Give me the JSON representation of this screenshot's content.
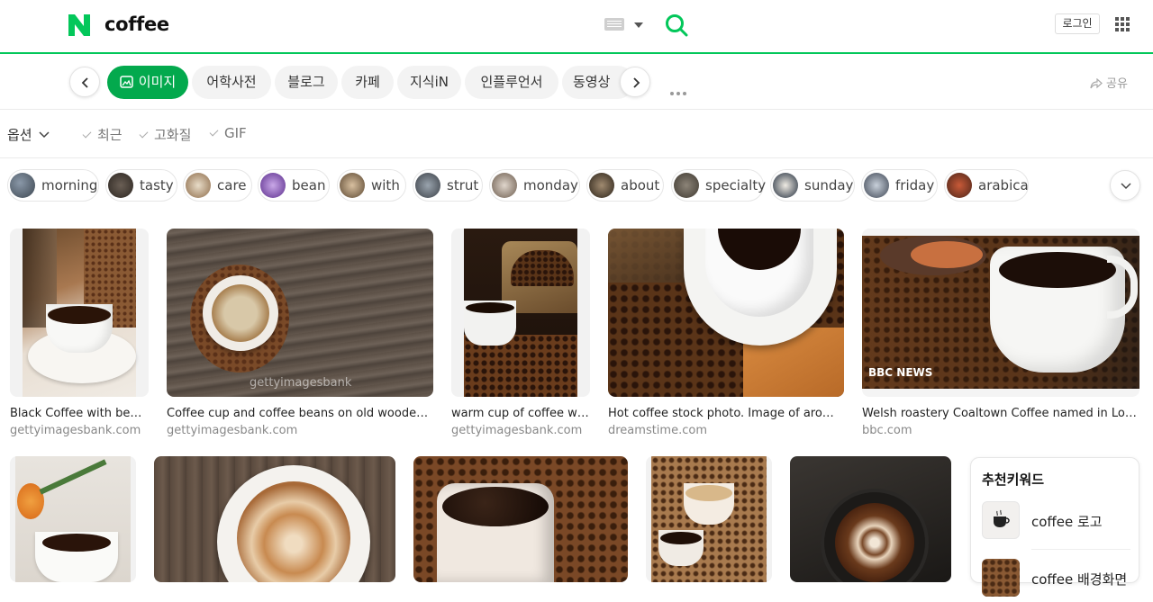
{
  "header": {
    "query": "coffee",
    "login_label": "로그인",
    "brand_color": "#03c75a"
  },
  "tabs": [
    {
      "label": "이미지",
      "active": true
    },
    {
      "label": "어학사전"
    },
    {
      "label": "블로그"
    },
    {
      "label": "카페"
    },
    {
      "label": "지식iN"
    },
    {
      "label": "인플루언서"
    },
    {
      "label": "동영상"
    }
  ],
  "share_label": "공유",
  "options": {
    "main_label": "옵션",
    "filters": [
      "최근",
      "고화질",
      "GIF"
    ]
  },
  "chips": [
    "morning",
    "tasty",
    "care",
    "bean",
    "with",
    "strut",
    "monday",
    "about",
    "specialty",
    "sunday",
    "friday",
    "arabica"
  ],
  "results_row1": [
    {
      "title": "Black Coffee with beans ...",
      "source": "gettyimagesbank.com"
    },
    {
      "title": "Coffee cup and coffee beans on old wooden tabl...",
      "source": "gettyimagesbank.com",
      "watermark": "gettyimagesbank"
    },
    {
      "title": "warm cup of coffee with...",
      "source": "gettyimagesbank.com"
    },
    {
      "title": "Hot coffee stock photo. Image of aroma, bl...",
      "source": "dreamstime.com"
    },
    {
      "title": "Welsh roastery Coaltown Coffee named in Lonely P...",
      "source": "bbc.com",
      "watermark": "BBC NEWS"
    }
  ],
  "recommended": {
    "title": "추천키워드",
    "items": [
      "coffee 로고",
      "coffee 배경화면"
    ]
  }
}
